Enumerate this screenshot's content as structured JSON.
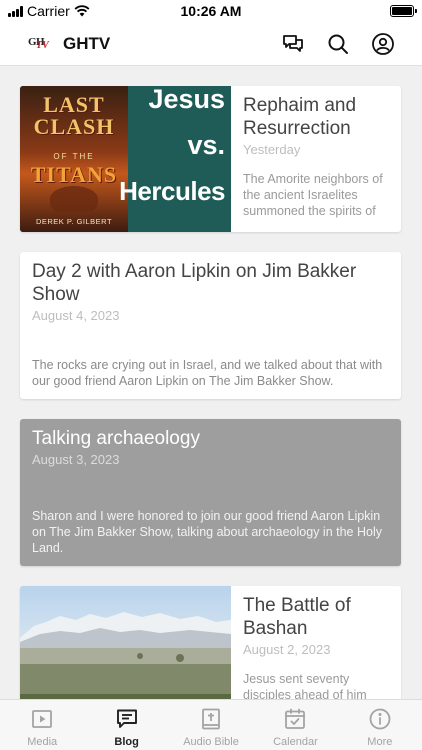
{
  "status_bar": {
    "carrier": "Carrier",
    "time": "10:26 AM"
  },
  "header": {
    "logo_text": "GH",
    "logo_text_accent": "TV",
    "title": "GHTV",
    "icons": [
      "chat-icon",
      "search-icon",
      "profile-icon"
    ]
  },
  "posts": [
    {
      "title": "Rephaim and Resurrection",
      "date": "Yesterday",
      "excerpt": "The Amorite neighbors of the ancient Israelites summoned the spirits of",
      "thumbnail": {
        "book_line1": "LAST",
        "book_line2": "CLASH",
        "book_line3": "OF THE",
        "book_line4": "TITANS",
        "book_author": "DEREK P. GILBERT",
        "side_line1": "Jesus",
        "side_line2": "vs.",
        "side_line3": "Hercules"
      }
    },
    {
      "title": "Day 2 with Aaron Lipkin on Jim Bakker Show",
      "date": "August 4, 2023",
      "excerpt": "The rocks are crying out in Israel, and we talked about that with our good friend Aaron Lipkin on The Jim Bakker Show."
    },
    {
      "title": "Talking archaeology",
      "date": "August 3, 2023",
      "excerpt": "Sharon and I were honored to join our good friend Aaron Lipkin on The Jim Bakker Show, talking about archaeology in the Holy Land."
    },
    {
      "title": "The Battle of Bashan",
      "date": "August 2, 2023",
      "excerpt": "Jesus sent seventy disciples ahead of him"
    }
  ],
  "tabbar": {
    "active": "Blog",
    "tabs": [
      {
        "label": "Media",
        "icon": "play-icon"
      },
      {
        "label": "Blog",
        "icon": "blog-icon"
      },
      {
        "label": "Audio Bible",
        "icon": "bible-icon"
      },
      {
        "label": "Calendar",
        "icon": "calendar-icon"
      },
      {
        "label": "More",
        "icon": "info-icon"
      }
    ]
  },
  "colors": {
    "accent": "#c0262d",
    "card_highlight": "#9e9e9e",
    "poster_bg": "#1f5c57"
  }
}
